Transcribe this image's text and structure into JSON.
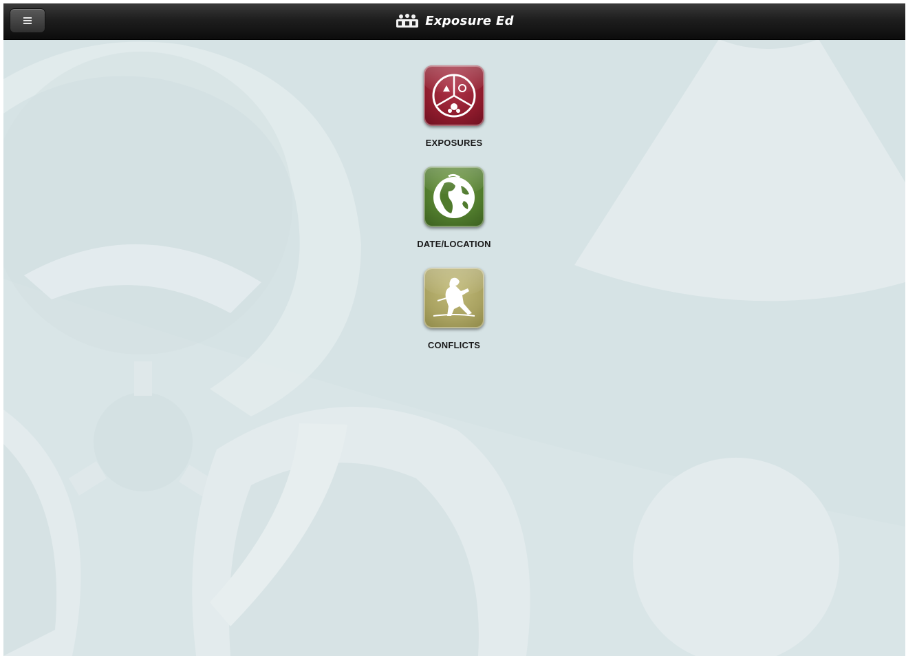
{
  "app": {
    "title": "Exposure Ed"
  },
  "header": {
    "menu_icon": "hamburger-menu-icon",
    "logo_icon": "people-group-icon"
  },
  "tiles": [
    {
      "label": "EXPOSURES",
      "icon": "hazard-symbols-icon",
      "color": "#8e1b2c"
    },
    {
      "label": "DATE/LOCATION",
      "icon": "globe-icon",
      "color": "#4f7a2c"
    },
    {
      "label": "CONFLICTS",
      "icon": "soldier-icon",
      "color": "#a9a261"
    }
  ],
  "colors": {
    "topbar": "#141414",
    "background": "#d6e3e5"
  }
}
